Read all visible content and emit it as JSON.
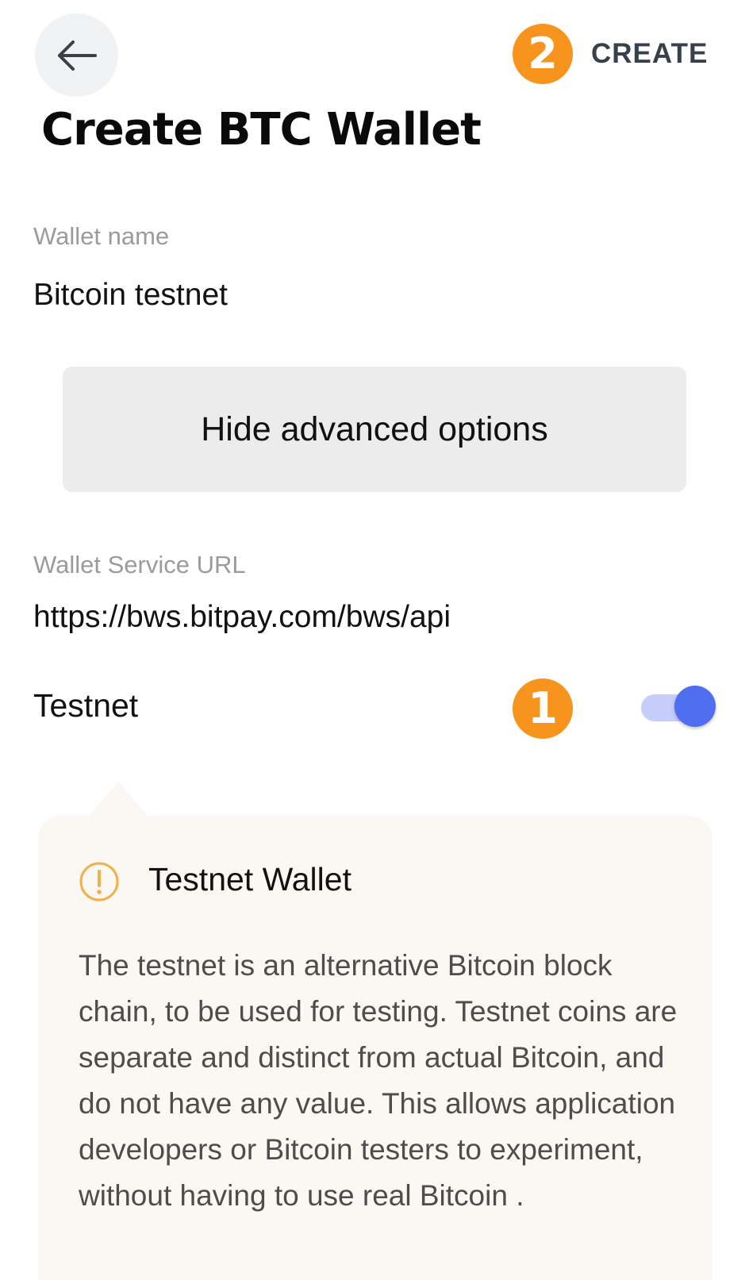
{
  "header": {
    "back_icon": "arrow-left-icon",
    "create_label": "CREATE",
    "step_badge_create": "2"
  },
  "title": "Create BTC Wallet",
  "wallet_name": {
    "label": "Wallet name",
    "value": "Bitcoin testnet"
  },
  "advanced_button_label": "Hide advanced options",
  "wallet_service": {
    "label": "Wallet Service URL",
    "value": "https://bws.bitpay.com/bws/api"
  },
  "testnet": {
    "label": "Testnet",
    "step_badge": "1",
    "enabled": true
  },
  "info": {
    "icon": "warning-circle-icon",
    "title": "Testnet Wallet",
    "body": "The testnet is an alternative Bitcoin block chain, to be used for testing. Testnet coins are separate and distinct from actual Bitcoin, and do not have any value. This allows application developers or Bitcoin testers to experiment, without having to use real Bitcoin ."
  },
  "colors": {
    "badge": "#f7941d",
    "toggle_knob": "#4f6ef0",
    "toggle_track": "#c6cdfb",
    "info_background": "#fbf8f3",
    "warning_icon": "#f2b04a"
  }
}
